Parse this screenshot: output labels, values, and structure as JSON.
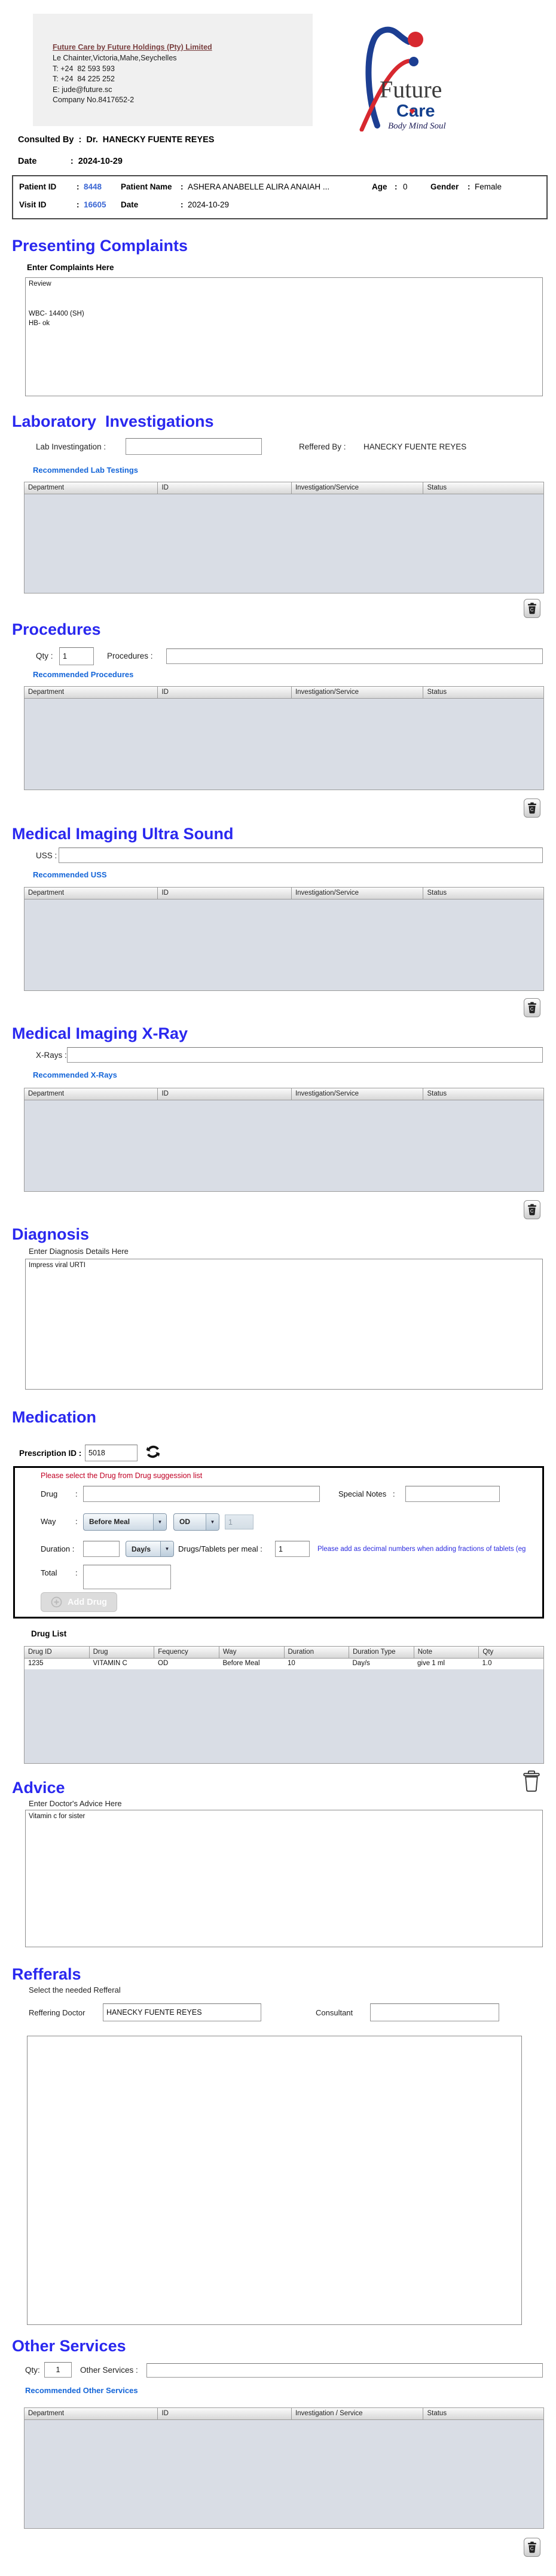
{
  "ui": {
    "colon": ":"
  },
  "icons": {
    "dropdown": "▼",
    "heart": "♥",
    "trash": "trash-can",
    "refresh": "refresh-arrows",
    "add": "circle-plus"
  },
  "colors": {
    "heading_blue": "#2a28ef",
    "link_blue": "#1465d8",
    "warning_red": "#c00024",
    "note_blue": "#2b2bdf",
    "id_blue": "#3a66d4",
    "drug_teal": "#2ba3a3",
    "logo_blue": "#1c3e92",
    "logo_red": "#d7282f",
    "table_body_gray": "#d9dde5"
  },
  "header": {
    "company_title": "Future Care by Future Holdings (Pty) Limited",
    "address": "Le Chainter,Victoria,Mahe,Seychelles",
    "phone1": "T: +24  82 593 593",
    "phone2": "T: +24  84 225 252",
    "email": "E: jude@future.sc",
    "company_no": "Company No.8417652-2",
    "logo": {
      "future": "Future",
      "care": "Care",
      "heart": "♥",
      "tagline": "Body Mind Soul"
    }
  },
  "consult": {
    "consulted_line": "Consulted By  :  Dr.  HANECKY FUENTE REYES",
    "date_line": "Date              :  2024-10-29"
  },
  "patient": {
    "patient_id_label": "Patient ID",
    "patient_id": "8448",
    "patient_name_label": "Patient Name",
    "patient_name": "ASHERA ANABELLE ALIRA ANAIAH ...",
    "age_label": "Age",
    "age": "0",
    "gender_label": "Gender",
    "gender": "Female",
    "visit_id_label": "Visit ID",
    "visit_id": "16605",
    "visit_date_label": "Date",
    "visit_date": "2024-10-29"
  },
  "sections": {
    "presenting": {
      "title": "Presenting Complaints",
      "label": "Enter Complaints Here",
      "text": "Review\n\n\nWBC- 14400 (SH)\nHB- ok"
    },
    "lab": {
      "title": "Laboratory  Investigations",
      "field_label": "Lab Investingation :",
      "field_value": "",
      "reffered_label": "Reffered By :",
      "reffered_value": "HANECKY FUENTE REYES",
      "link": "Recommended Lab Testings"
    },
    "procedures": {
      "title": "Procedures",
      "qty_label": "Qty :",
      "qty_value": "1",
      "field_label": "Procedures :",
      "field_value": "",
      "link": "Recommended Procedures"
    },
    "uss": {
      "title": "Medical Imaging Ultra Sound",
      "field_label": "USS :",
      "field_value": "",
      "link": "Recommended USS"
    },
    "xray": {
      "title": "Medical Imaging X-Ray",
      "field_label": "X-Rays :",
      "field_value": "",
      "link": "Recommended X-Rays"
    },
    "diagnosis": {
      "title": "Diagnosis",
      "label": "Enter Diagnosis Details Here",
      "text": "Impress viral URTI"
    },
    "medication": {
      "title": "Medication",
      "prescription_label": "Prescription ID :",
      "prescription_id": "5018",
      "warning": "Please select the Drug from Drug suggession list",
      "drug_label": "Drug",
      "drug_value": "",
      "special_notes_label": "Special Notes",
      "special_notes_value": "",
      "way_label": "Way",
      "meal_select": "Before Meal",
      "freq_select": "OD",
      "way_qty": "1",
      "duration_label": "Duration :",
      "duration_value": "",
      "duration_type_select": "Day/s",
      "per_meal_label": "Drugs/Tablets per meal :",
      "per_meal_value": "1",
      "fraction_note": "Please add as decimal numbers when adding fractions of tablets (eg",
      "total_label": "Total",
      "total_value": "",
      "add_drug_label": "Add Drug",
      "drug_list_label": "Drug List"
    },
    "advice": {
      "title": "Advice",
      "label": "Enter Doctor's Advice Here",
      "text": "Vitamin c for sister"
    },
    "refferals": {
      "title": "Refferals",
      "subtitle": "Select the needed Refferal",
      "doctor_label": "Reffering Doctor",
      "doctor_value": "HANECKY FUENTE REYES",
      "consultant_label": "Consultant",
      "consultant_value": ""
    },
    "other": {
      "title": "Other Services",
      "qty_label": "Qty:",
      "qty_value": "1",
      "field_label": "Other Services :",
      "field_value": "",
      "link": "Recommended Other Services"
    }
  },
  "tables": {
    "invest_headers": [
      "Department",
      "ID",
      "Investigation/Service",
      "Status"
    ],
    "other_headers": [
      "Department",
      "ID",
      "Investigation / Service",
      "Status"
    ],
    "drug_headers": [
      "Drug ID",
      "Drug",
      "Fequency",
      "Way",
      "Duration",
      "Duration Type",
      "Note",
      "Qty"
    ],
    "drug_rows": [
      [
        "1235",
        "VITAMIN C",
        "OD",
        "Before Meal",
        "10",
        "Day/s",
        "give 1 ml",
        "1.0"
      ]
    ]
  }
}
